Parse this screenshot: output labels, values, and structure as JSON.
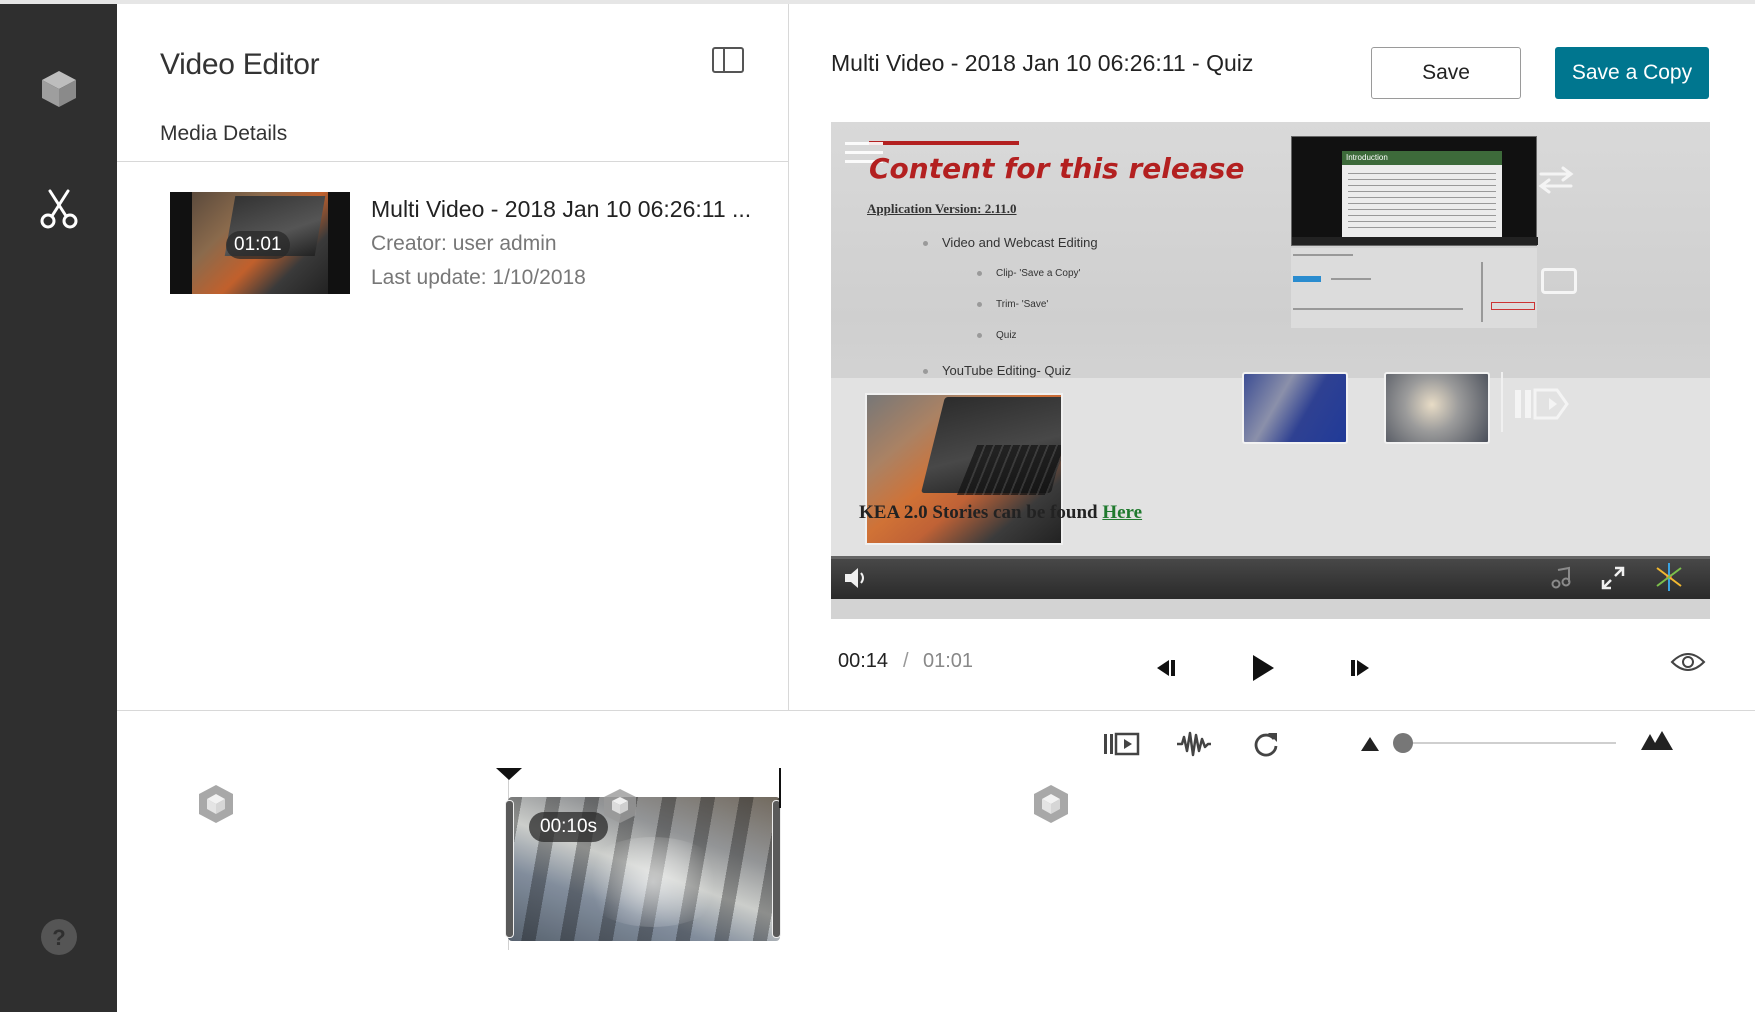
{
  "sidebar": {
    "items": [
      {
        "name": "entries",
        "icon": "cube-icon"
      },
      {
        "name": "video-editor",
        "icon": "scissors-icon"
      }
    ],
    "help_icon": "question-icon"
  },
  "left_panel": {
    "title": "Video Editor",
    "section_label": "Media Details",
    "media": {
      "name": "Multi Video - 2018 Jan 10 06:26:11 ...",
      "creator": "Creator: user admin",
      "last_update": "Last update: 1/10/2018",
      "duration": "01:01"
    }
  },
  "right_panel": {
    "entry_title": "Multi Video - 2018 Jan 10 06:26:11 - Quiz",
    "save_label": "Save",
    "save_copy_label": "Save a Copy",
    "accent_color": "#00768f",
    "player": {
      "slide_heading": "Content for this release",
      "app_version": "Application Version: 2.11.0",
      "lines": [
        "Video and Webcast Editing",
        "Clip- 'Save a Copy'",
        "Trim- 'Save'",
        "Quiz",
        "YouTube Editing- Quiz"
      ],
      "screen_title": "Introduction",
      "footer_text": "KEA 2.0 Stories can be found",
      "footer_link": "Here"
    },
    "transport": {
      "current_time": "00:14",
      "separator": "/",
      "total_time": "01:01"
    }
  },
  "timeline": {
    "clip_duration": "00:10s"
  }
}
